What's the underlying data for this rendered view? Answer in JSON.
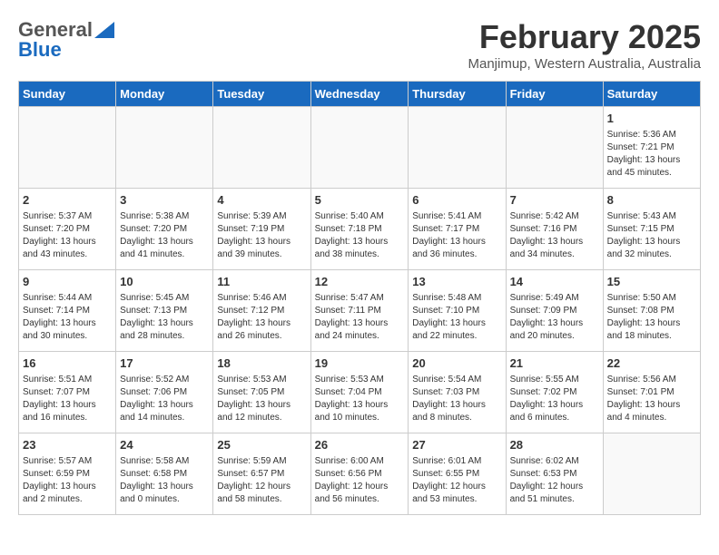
{
  "header": {
    "logo_general": "General",
    "logo_blue": "Blue",
    "month_year": "February 2025",
    "location": "Manjimup, Western Australia, Australia"
  },
  "days_of_week": [
    "Sunday",
    "Monday",
    "Tuesday",
    "Wednesday",
    "Thursday",
    "Friday",
    "Saturday"
  ],
  "weeks": [
    [
      {
        "day": "",
        "info": ""
      },
      {
        "day": "",
        "info": ""
      },
      {
        "day": "",
        "info": ""
      },
      {
        "day": "",
        "info": ""
      },
      {
        "day": "",
        "info": ""
      },
      {
        "day": "",
        "info": ""
      },
      {
        "day": "1",
        "info": "Sunrise: 5:36 AM\nSunset: 7:21 PM\nDaylight: 13 hours\nand 45 minutes."
      }
    ],
    [
      {
        "day": "2",
        "info": "Sunrise: 5:37 AM\nSunset: 7:20 PM\nDaylight: 13 hours\nand 43 minutes."
      },
      {
        "day": "3",
        "info": "Sunrise: 5:38 AM\nSunset: 7:20 PM\nDaylight: 13 hours\nand 41 minutes."
      },
      {
        "day": "4",
        "info": "Sunrise: 5:39 AM\nSunset: 7:19 PM\nDaylight: 13 hours\nand 39 minutes."
      },
      {
        "day": "5",
        "info": "Sunrise: 5:40 AM\nSunset: 7:18 PM\nDaylight: 13 hours\nand 38 minutes."
      },
      {
        "day": "6",
        "info": "Sunrise: 5:41 AM\nSunset: 7:17 PM\nDaylight: 13 hours\nand 36 minutes."
      },
      {
        "day": "7",
        "info": "Sunrise: 5:42 AM\nSunset: 7:16 PM\nDaylight: 13 hours\nand 34 minutes."
      },
      {
        "day": "8",
        "info": "Sunrise: 5:43 AM\nSunset: 7:15 PM\nDaylight: 13 hours\nand 32 minutes."
      }
    ],
    [
      {
        "day": "9",
        "info": "Sunrise: 5:44 AM\nSunset: 7:14 PM\nDaylight: 13 hours\nand 30 minutes."
      },
      {
        "day": "10",
        "info": "Sunrise: 5:45 AM\nSunset: 7:13 PM\nDaylight: 13 hours\nand 28 minutes."
      },
      {
        "day": "11",
        "info": "Sunrise: 5:46 AM\nSunset: 7:12 PM\nDaylight: 13 hours\nand 26 minutes."
      },
      {
        "day": "12",
        "info": "Sunrise: 5:47 AM\nSunset: 7:11 PM\nDaylight: 13 hours\nand 24 minutes."
      },
      {
        "day": "13",
        "info": "Sunrise: 5:48 AM\nSunset: 7:10 PM\nDaylight: 13 hours\nand 22 minutes."
      },
      {
        "day": "14",
        "info": "Sunrise: 5:49 AM\nSunset: 7:09 PM\nDaylight: 13 hours\nand 20 minutes."
      },
      {
        "day": "15",
        "info": "Sunrise: 5:50 AM\nSunset: 7:08 PM\nDaylight: 13 hours\nand 18 minutes."
      }
    ],
    [
      {
        "day": "16",
        "info": "Sunrise: 5:51 AM\nSunset: 7:07 PM\nDaylight: 13 hours\nand 16 minutes."
      },
      {
        "day": "17",
        "info": "Sunrise: 5:52 AM\nSunset: 7:06 PM\nDaylight: 13 hours\nand 14 minutes."
      },
      {
        "day": "18",
        "info": "Sunrise: 5:53 AM\nSunset: 7:05 PM\nDaylight: 13 hours\nand 12 minutes."
      },
      {
        "day": "19",
        "info": "Sunrise: 5:53 AM\nSunset: 7:04 PM\nDaylight: 13 hours\nand 10 minutes."
      },
      {
        "day": "20",
        "info": "Sunrise: 5:54 AM\nSunset: 7:03 PM\nDaylight: 13 hours\nand 8 minutes."
      },
      {
        "day": "21",
        "info": "Sunrise: 5:55 AM\nSunset: 7:02 PM\nDaylight: 13 hours\nand 6 minutes."
      },
      {
        "day": "22",
        "info": "Sunrise: 5:56 AM\nSunset: 7:01 PM\nDaylight: 13 hours\nand 4 minutes."
      }
    ],
    [
      {
        "day": "23",
        "info": "Sunrise: 5:57 AM\nSunset: 6:59 PM\nDaylight: 13 hours\nand 2 minutes."
      },
      {
        "day": "24",
        "info": "Sunrise: 5:58 AM\nSunset: 6:58 PM\nDaylight: 13 hours\nand 0 minutes."
      },
      {
        "day": "25",
        "info": "Sunrise: 5:59 AM\nSunset: 6:57 PM\nDaylight: 12 hours\nand 58 minutes."
      },
      {
        "day": "26",
        "info": "Sunrise: 6:00 AM\nSunset: 6:56 PM\nDaylight: 12 hours\nand 56 minutes."
      },
      {
        "day": "27",
        "info": "Sunrise: 6:01 AM\nSunset: 6:55 PM\nDaylight: 12 hours\nand 53 minutes."
      },
      {
        "day": "28",
        "info": "Sunrise: 6:02 AM\nSunset: 6:53 PM\nDaylight: 12 hours\nand 51 minutes."
      },
      {
        "day": "",
        "info": ""
      }
    ]
  ]
}
